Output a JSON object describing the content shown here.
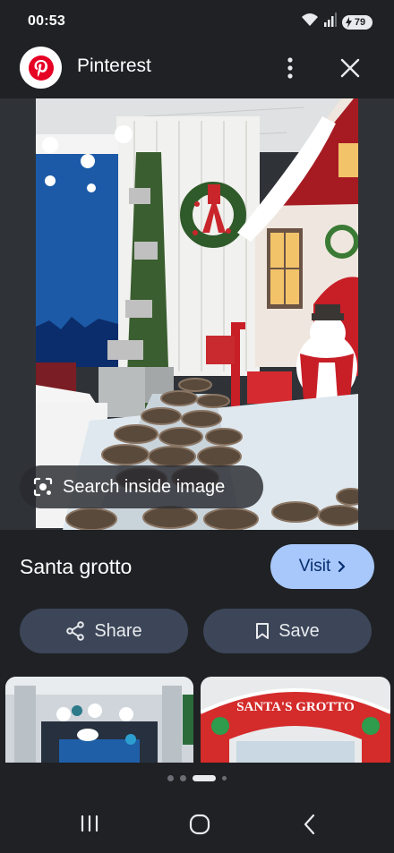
{
  "status_bar": {
    "time": "00:53",
    "battery": "79",
    "icons": [
      "wifi-icon",
      "signal-icon",
      "battery-icon"
    ]
  },
  "header": {
    "app_name": "Pinterest",
    "logo_icon": "pinterest-logo-icon",
    "actions": [
      "more-vert-icon",
      "close-icon"
    ]
  },
  "image": {
    "search_inside_label": "Search inside image"
  },
  "pin": {
    "title": "Santa grotto",
    "visit_label": "Visit",
    "share_label": "Share",
    "save_label": "Save"
  },
  "related": {
    "thumb_2_text": "SANTA'S GROTTO"
  },
  "pagination": {
    "dots": 4,
    "active": 2
  },
  "nav": [
    "recents-icon",
    "home-icon",
    "back-icon"
  ],
  "colors": {
    "background": "#1f2124",
    "visit_button": "#a8c7fa",
    "secondary_button": "#3c4658",
    "pinterest_red": "#e60023"
  }
}
